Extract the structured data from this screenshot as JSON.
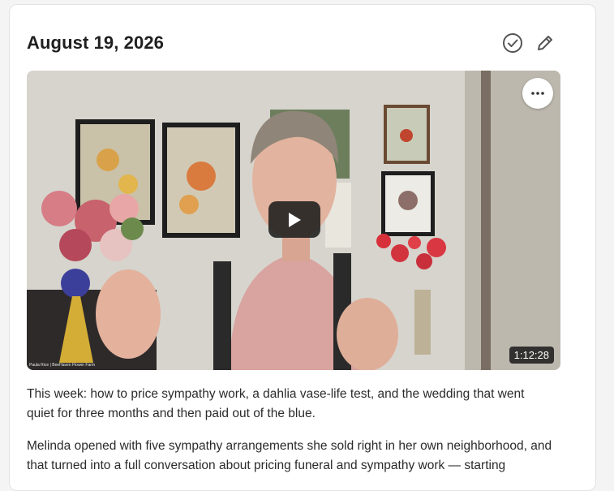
{
  "post": {
    "date": "August 19, 2026",
    "actions": {
      "complete_icon": "check-circle-icon",
      "edit_icon": "pencil-icon"
    }
  },
  "video": {
    "duration": "1:12:28",
    "caption": "Paula Rice | BeeHaven Flower Farm",
    "more_icon": "more-horizontal-icon",
    "play_icon": "play-icon"
  },
  "body": {
    "paragraph1": "This week: how to price sympathy work, a dahlia vase-life test, and the wedding that went quiet for three months and then paid out of the blue.",
    "paragraph2": "Melinda opened with five sympathy arrangements she sold right in her own neighborhood, and that turned into a full conversation about pricing funeral and sympathy work — starting"
  }
}
